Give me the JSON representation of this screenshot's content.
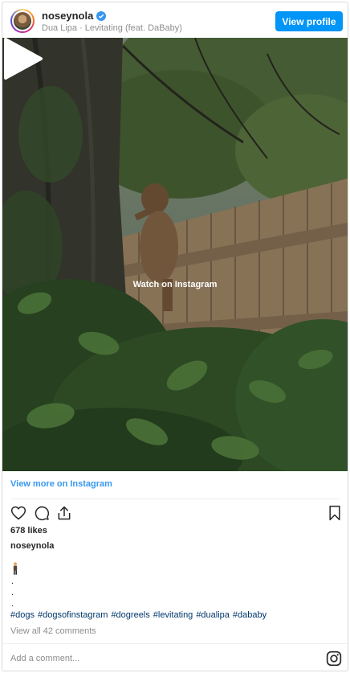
{
  "header": {
    "username": "noseynola",
    "subtitle": "Dua Lipa · Levitating (feat. DaBaby)",
    "view_profile_label": "View profile",
    "verified": true
  },
  "media": {
    "watch_label": "Watch on Instagram"
  },
  "view_more_label": "View more on Instagram",
  "actions": {
    "like_icon": "heart-icon",
    "comment_icon": "comment-icon",
    "share_icon": "share-icon",
    "save_icon": "bookmark-icon"
  },
  "likes": "678 likes",
  "caption": {
    "username": "noseynola",
    "emoji": "man-standing-emoji",
    "dots": [
      ".",
      ".",
      "."
    ],
    "hashtags": [
      "#dogs",
      "#dogsofinstagram",
      "#dogreels",
      "#levitating",
      "#dualipa",
      "#dababy"
    ]
  },
  "comments_link": "View all 42 comments",
  "comment_input": {
    "placeholder": "Add a comment..."
  },
  "colors": {
    "accent": "#0095f6",
    "link": "#3897f0",
    "hashtag": "#00376b",
    "muted": "#8e8e8e"
  }
}
